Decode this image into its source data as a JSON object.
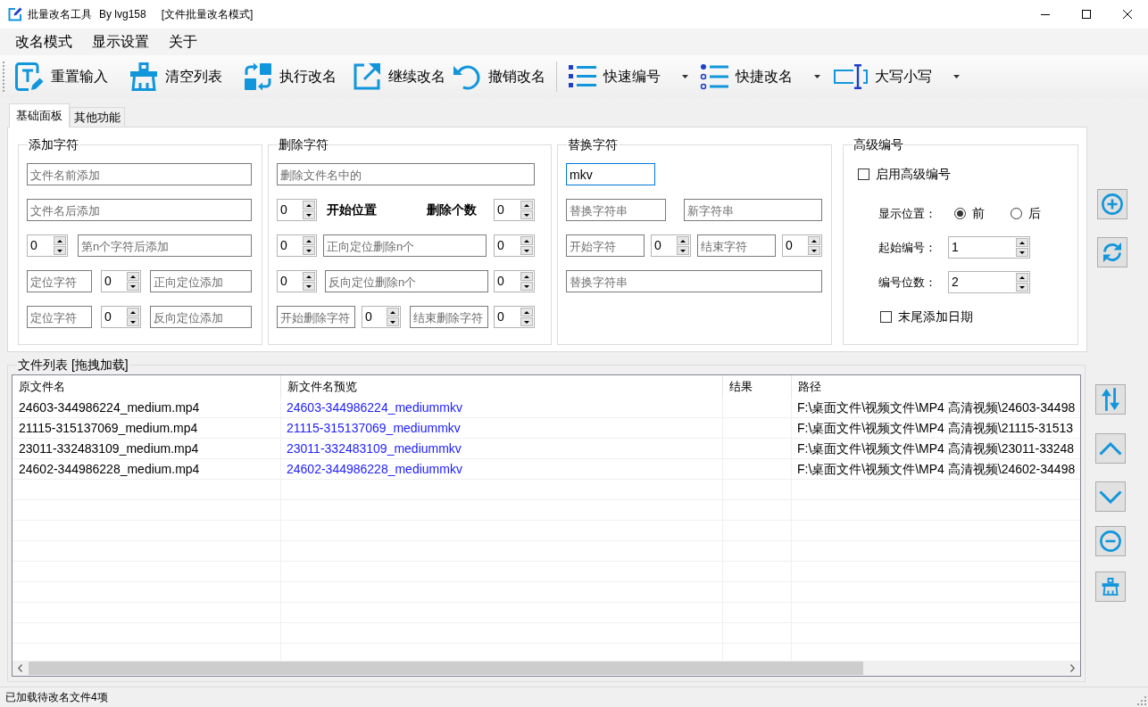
{
  "window": {
    "title": "批量改名工具",
    "author": "By lvg158",
    "mode": "[文件批量改名模式]"
  },
  "menu": [
    {
      "label": "改名模式"
    },
    {
      "label": "显示设置"
    },
    {
      "label": "关于"
    }
  ],
  "toolbar": [
    {
      "label": "重置输入",
      "dropdown": false
    },
    {
      "label": "清空列表",
      "dropdown": false
    },
    {
      "label": "执行改名",
      "dropdown": false
    },
    {
      "label": "继续改名",
      "dropdown": false
    },
    {
      "label": "撤销改名",
      "dropdown": false
    },
    {
      "label": "快速编号",
      "dropdown": true
    },
    {
      "label": "快捷改名",
      "dropdown": true
    },
    {
      "label": "大写小写",
      "dropdown": true
    }
  ],
  "tabs": [
    {
      "label": "基础面板",
      "selected": true
    },
    {
      "label": "其他功能",
      "selected": false
    }
  ],
  "groups": [
    {
      "title": "添加字符",
      "rows": [
        {
          "items": [
            {
              "kind": "field",
              "placeholder": "文件名前添加",
              "focused": false
            }
          ]
        },
        {
          "items": [
            {
              "kind": "field",
              "placeholder": "文件名后添加",
              "focused": false
            }
          ]
        },
        {
          "items": [
            {
              "kind": "spinner",
              "value": "0"
            },
            {
              "kind": "field",
              "placeholder": "第n个字符后添加",
              "focused": false
            }
          ]
        },
        {
          "items": [
            {
              "kind": "field",
              "placeholder": "定位字符",
              "focused": false
            },
            {
              "kind": "spinner",
              "value": "0"
            },
            {
              "kind": "field",
              "placeholder": "正向定位添加",
              "focused": false
            }
          ]
        },
        {
          "items": [
            {
              "kind": "field",
              "placeholder": "定位字符",
              "focused": false
            },
            {
              "kind": "spinner",
              "value": "0"
            },
            {
              "kind": "field",
              "placeholder": "反向定位添加",
              "focused": false
            }
          ]
        }
      ]
    },
    {
      "title": "删除字符",
      "rows": [
        {
          "items": [
            {
              "kind": "field",
              "placeholder": "删除文件名中的",
              "focused": false
            }
          ]
        },
        {
          "items": [
            {
              "kind": "spinner",
              "value": "0"
            },
            {
              "kind": "label",
              "text": "开始位置"
            },
            {
              "kind": "label",
              "text": "删除个数"
            },
            {
              "kind": "spinner",
              "value": "0"
            }
          ]
        },
        {
          "items": [
            {
              "kind": "spinner",
              "value": "0"
            },
            {
              "kind": "field",
              "placeholder": "正向定位删除n个",
              "focused": false
            },
            {
              "kind": "spinner",
              "value": "0"
            }
          ]
        },
        {
          "items": [
            {
              "kind": "spinner",
              "value": "0"
            },
            {
              "kind": "field",
              "placeholder": "反向定位删除n个",
              "focused": false
            },
            {
              "kind": "spinner",
              "value": "0"
            }
          ]
        },
        {
          "items": [
            {
              "kind": "field",
              "placeholder": "开始删除字符",
              "focused": false
            },
            {
              "kind": "spinner",
              "value": "0"
            },
            {
              "kind": "field",
              "placeholder": "结束删除字符",
              "focused": false
            },
            {
              "kind": "spinner",
              "value": "0"
            }
          ]
        }
      ]
    },
    {
      "title": "替换字符",
      "rows": [
        {
          "items": [
            {
              "kind": "field",
              "value": "mkv",
              "focused": true
            }
          ]
        },
        {
          "items": [
            {
              "kind": "field",
              "placeholder": "替换字符串",
              "focused": false
            },
            {
              "kind": "field",
              "placeholder": "新字符串",
              "focused": false
            }
          ]
        },
        {
          "items": [
            {
              "kind": "field",
              "placeholder": "开始字符",
              "focused": false
            },
            {
              "kind": "spinner",
              "value": "0"
            },
            {
              "kind": "field",
              "placeholder": "结束字符",
              "focused": false
            },
            {
              "kind": "spinner",
              "value": "0"
            }
          ]
        },
        {
          "items": [
            {
              "kind": "field",
              "placeholder": "替换字符串",
              "focused": false
            }
          ]
        }
      ]
    },
    {
      "title": "高级编号",
      "rows": [
        {
          "items": [
            {
              "kind": "checkbox",
              "label": "启用高级编号",
              "checked": false
            }
          ]
        },
        {
          "items": [
            {
              "kind": "label",
              "text": "显示位置："
            },
            {
              "kind": "radio",
              "label": "前",
              "selected": true
            },
            {
              "kind": "radio",
              "label": "后",
              "selected": false
            }
          ]
        },
        {
          "items": [
            {
              "kind": "label",
              "text": "起始编号："
            },
            {
              "kind": "spinner",
              "value": "1"
            }
          ]
        },
        {
          "items": [
            {
              "kind": "label",
              "text": "编号位数："
            },
            {
              "kind": "spinner",
              "value": "2"
            }
          ]
        },
        {
          "items": [
            {
              "kind": "checkbox",
              "label": "末尾添加日期",
              "checked": false
            }
          ]
        }
      ]
    }
  ],
  "file_list": {
    "title": "文件列表 [拖拽加载]",
    "columns": [
      "原文件名",
      "新文件名预览",
      "结果",
      "路径"
    ],
    "rows": [
      {
        "original": "24603-344986224_medium.mp4",
        "preview": "24603-344986224_mediummkv",
        "path": "F:\\桌面文件\\视频文件\\MP4 高清视频\\24603-34498"
      },
      {
        "original": "21115-315137069_medium.mp4",
        "preview": "21115-315137069_mediummkv",
        "path": "F:\\桌面文件\\视频文件\\MP4 高清视频\\21115-31513"
      },
      {
        "original": "23011-332483109_medium.mp4",
        "preview": "23011-332483109_mediummkv",
        "path": "F:\\桌面文件\\视频文件\\MP4 高清视频\\23011-33248"
      },
      {
        "original": "24602-344986228_medium.mp4",
        "preview": "24602-344986228_mediummkv",
        "path": "F:\\桌面文件\\视频文件\\MP4 高清视频\\24602-34498"
      }
    ]
  },
  "status_bar": "已加载待改名文件4项"
}
